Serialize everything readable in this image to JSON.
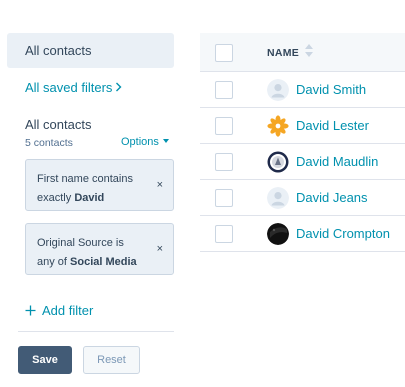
{
  "sidebar": {
    "view_label": "All contacts",
    "saved_filters_label": "All saved filters",
    "group_title": "All contacts",
    "contact_count": "5 contacts",
    "options_label": "Options",
    "filters": [
      {
        "prefix": "First name contains",
        "connector": "exactly",
        "value": "David",
        "remove_glyph": "×"
      },
      {
        "prefix": "Original Source is",
        "connector": "any of",
        "value": "Social Media",
        "remove_glyph": "×"
      }
    ],
    "add_filter_label": "Add filter",
    "save_label": "Save",
    "reset_label": "Reset"
  },
  "table": {
    "column_header": "NAME",
    "rows": [
      {
        "name": "David Smith",
        "avatar": "default-person-avatar"
      },
      {
        "name": "David Lester",
        "avatar": "orange-pinwheel-avatar"
      },
      {
        "name": "David Maudlin",
        "avatar": "emblem-avatar"
      },
      {
        "name": "David Jeans",
        "avatar": "default-person-avatar"
      },
      {
        "name": "David Crompton",
        "avatar": "dark-photo-avatar"
      }
    ]
  },
  "colors": {
    "link": "#0091ae",
    "text": "#33475b",
    "panel_bg": "#eaf0f6",
    "border": "#cbd6e2",
    "save_button": "#425b76"
  }
}
